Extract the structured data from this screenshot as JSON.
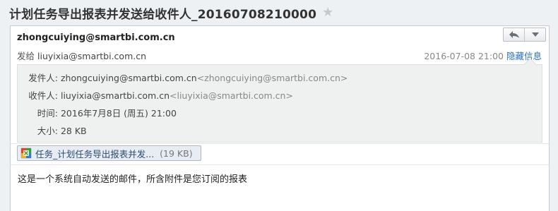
{
  "subject": "计划任务导出报表并发送给收件人_20160708210000",
  "header": {
    "sender_name": "zhongcuiying@smartbi.com.cn",
    "to_label": "发给",
    "to_addr": "liuyixia@smartbi.com.cn",
    "date": "2016-07-08 21:00",
    "toggle_label": "隐藏信息"
  },
  "details": {
    "from_label": "发件人:",
    "from_name": "zhongcuiying@smartbi.com.cn",
    "from_addr": "<zhongcuiying@smartbi.com.cn>",
    "to_label": "收件人:",
    "to_name": "liuyixia@smartbi.com.cn",
    "to_addr": "<liuyixia@smartbi.com.cn>",
    "time_label": "时间:",
    "time_value": "2016年7月8日 (周五) 21:00",
    "size_label": "大小:",
    "size_value": "28 KB"
  },
  "attachment": {
    "name": "任务_计划任务导出报表并发...",
    "size": "(19 KB)"
  },
  "body_text": "这是一个系统自动发送的邮件，所含附件是您订阅的报表",
  "colors": {
    "link": "#2a6fbb",
    "star": "#c8c8c8",
    "detail_bg": "#eef1f0"
  },
  "icons": [
    "star-icon",
    "reply-icon",
    "dropdown-icon",
    "excel-file-icon"
  ]
}
